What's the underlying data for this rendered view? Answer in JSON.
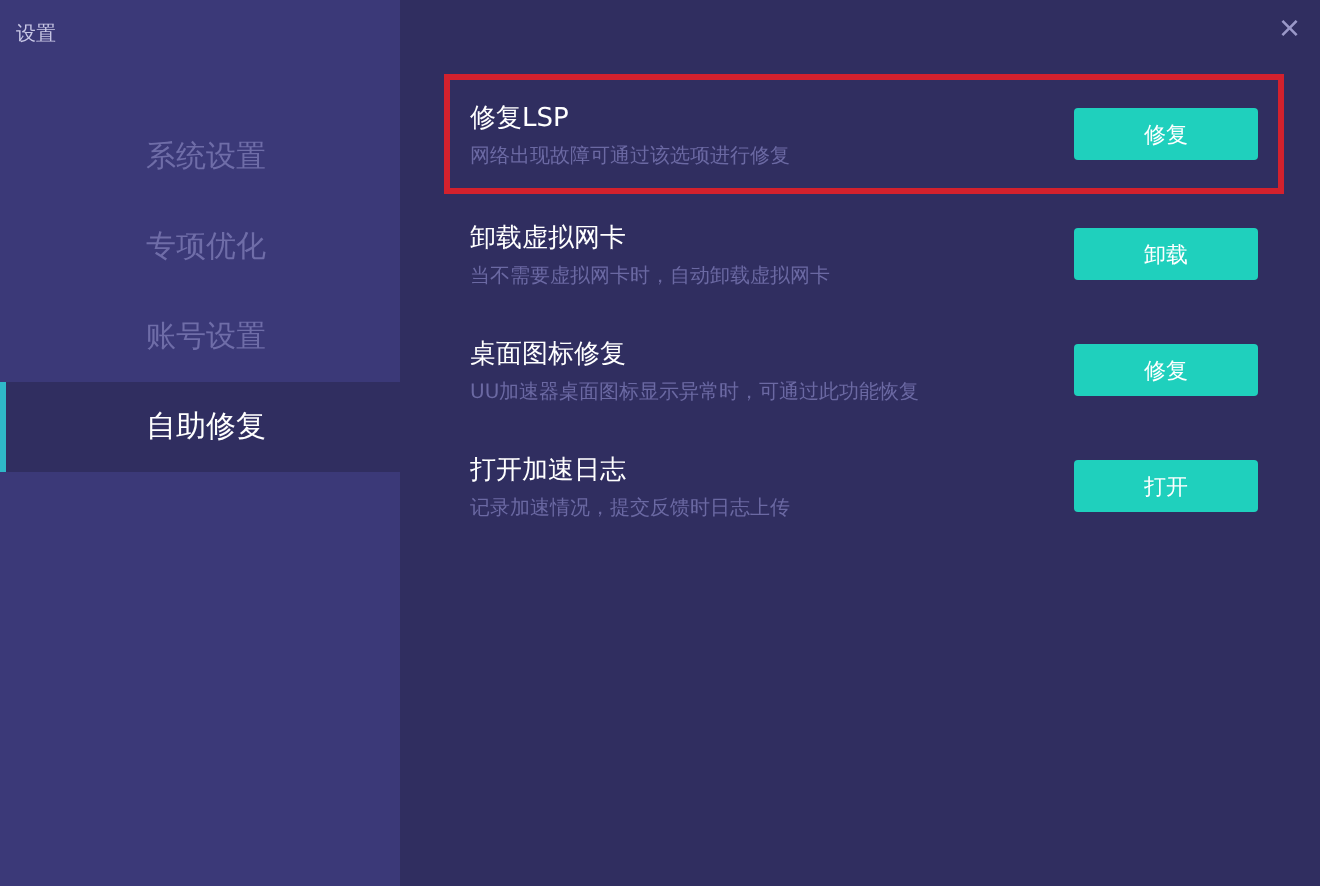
{
  "window": {
    "title": "设置",
    "close": "×"
  },
  "sidebar": {
    "items": [
      {
        "label": "系统设置",
        "selected": false
      },
      {
        "label": "专项优化",
        "selected": false
      },
      {
        "label": "账号设置",
        "selected": false
      },
      {
        "label": "自助修复",
        "selected": true
      }
    ]
  },
  "options": [
    {
      "title": "修复LSP",
      "description": "网络出现故障可通过该选项进行修复",
      "button": "修复",
      "highlighted": true
    },
    {
      "title": "卸载虚拟网卡",
      "description": "当不需要虚拟网卡时，自动卸载虚拟网卡",
      "button": "卸载",
      "highlighted": false
    },
    {
      "title": "桌面图标修复",
      "description": "UU加速器桌面图标显示异常时，可通过此功能恢复",
      "button": "修复",
      "highlighted": false
    },
    {
      "title": "打开加速日志",
      "description": "记录加速情况，提交反馈时日志上传",
      "button": "打开",
      "highlighted": false
    }
  ]
}
